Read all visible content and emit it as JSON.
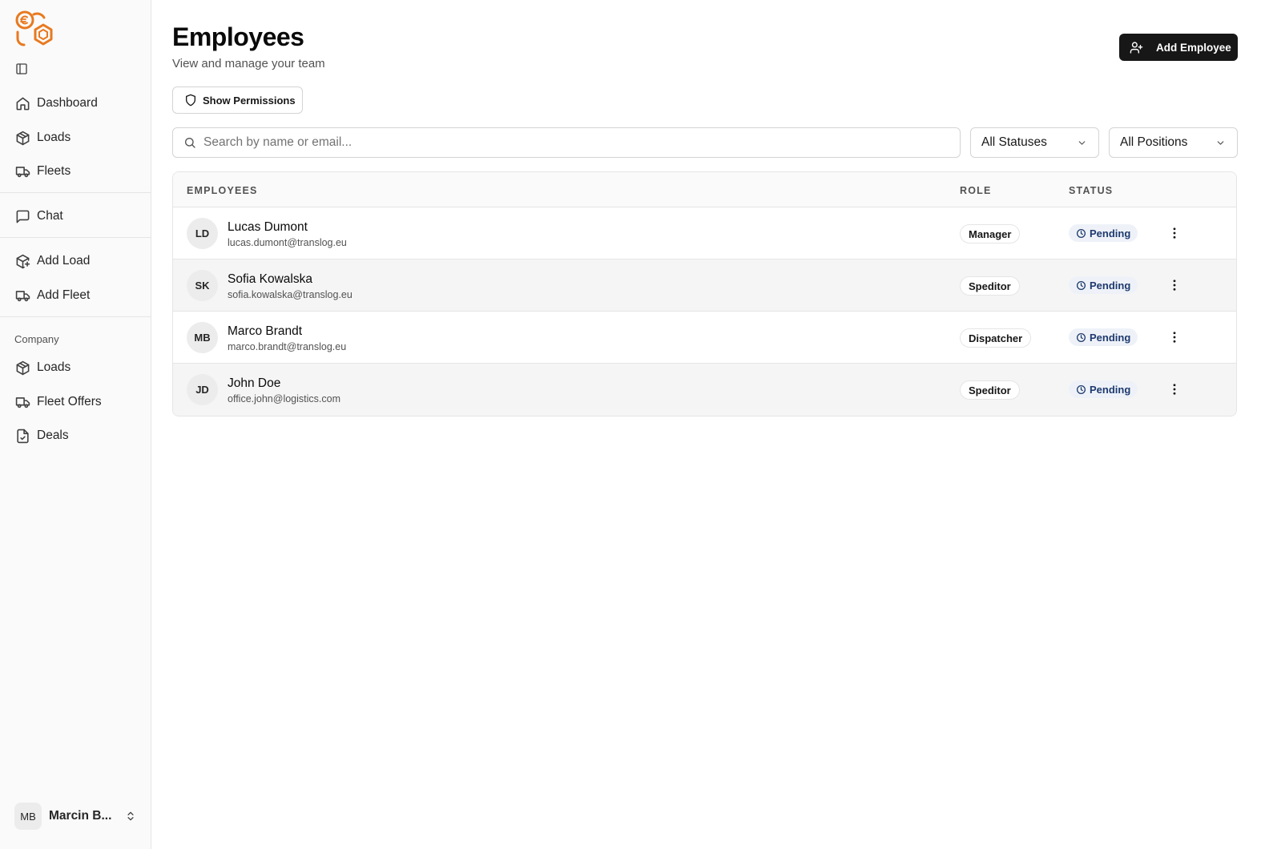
{
  "sidebar": {
    "nav_main": [
      {
        "label": "Dashboard",
        "icon": "home-icon"
      },
      {
        "label": "Loads",
        "icon": "package-icon"
      },
      {
        "label": "Fleets",
        "icon": "truck-icon"
      }
    ],
    "nav_chat": [
      {
        "label": "Chat",
        "icon": "message-square-icon"
      }
    ],
    "nav_add": [
      {
        "label": "Add Load",
        "icon": "package-plus-icon"
      },
      {
        "label": "Add Fleet",
        "icon": "truck-icon"
      }
    ],
    "company_label": "Company",
    "nav_company": [
      {
        "label": "Loads",
        "icon": "package-icon"
      },
      {
        "label": "Fleet Offers",
        "icon": "truck-icon"
      },
      {
        "label": "Deals",
        "icon": "file-check-icon"
      }
    ],
    "user": {
      "initials": "MB",
      "name": "Marcin B..."
    }
  },
  "header": {
    "title": "Employees",
    "subtitle": "View and manage your team",
    "add_button": "Add Employee",
    "permissions_button": "Show Permissions"
  },
  "filters": {
    "search_placeholder": "Search by name or email...",
    "status_selected": "All Statuses",
    "position_selected": "All Positions"
  },
  "table": {
    "columns": [
      "EMPLOYEES",
      "ROLE",
      "STATUS"
    ],
    "rows": [
      {
        "initials": "LD",
        "name": "Lucas Dumont",
        "email": "lucas.dumont@translog.eu",
        "role": "Manager",
        "status": "Pending"
      },
      {
        "initials": "SK",
        "name": "Sofia Kowalska",
        "email": "sofia.kowalska@translog.eu",
        "role": "Speditor",
        "status": "Pending"
      },
      {
        "initials": "MB",
        "name": "Marco Brandt",
        "email": "marco.brandt@translog.eu",
        "role": "Dispatcher",
        "status": "Pending"
      },
      {
        "initials": "JD",
        "name": "John Doe",
        "email": "office.john@logistics.com",
        "role": "Speditor",
        "status": "Pending"
      }
    ]
  },
  "colors": {
    "brand": "#e8791f",
    "primary_button": "#171717",
    "status_pending_bg": "#eef2f8",
    "status_pending_text": "#1e3a6e"
  }
}
